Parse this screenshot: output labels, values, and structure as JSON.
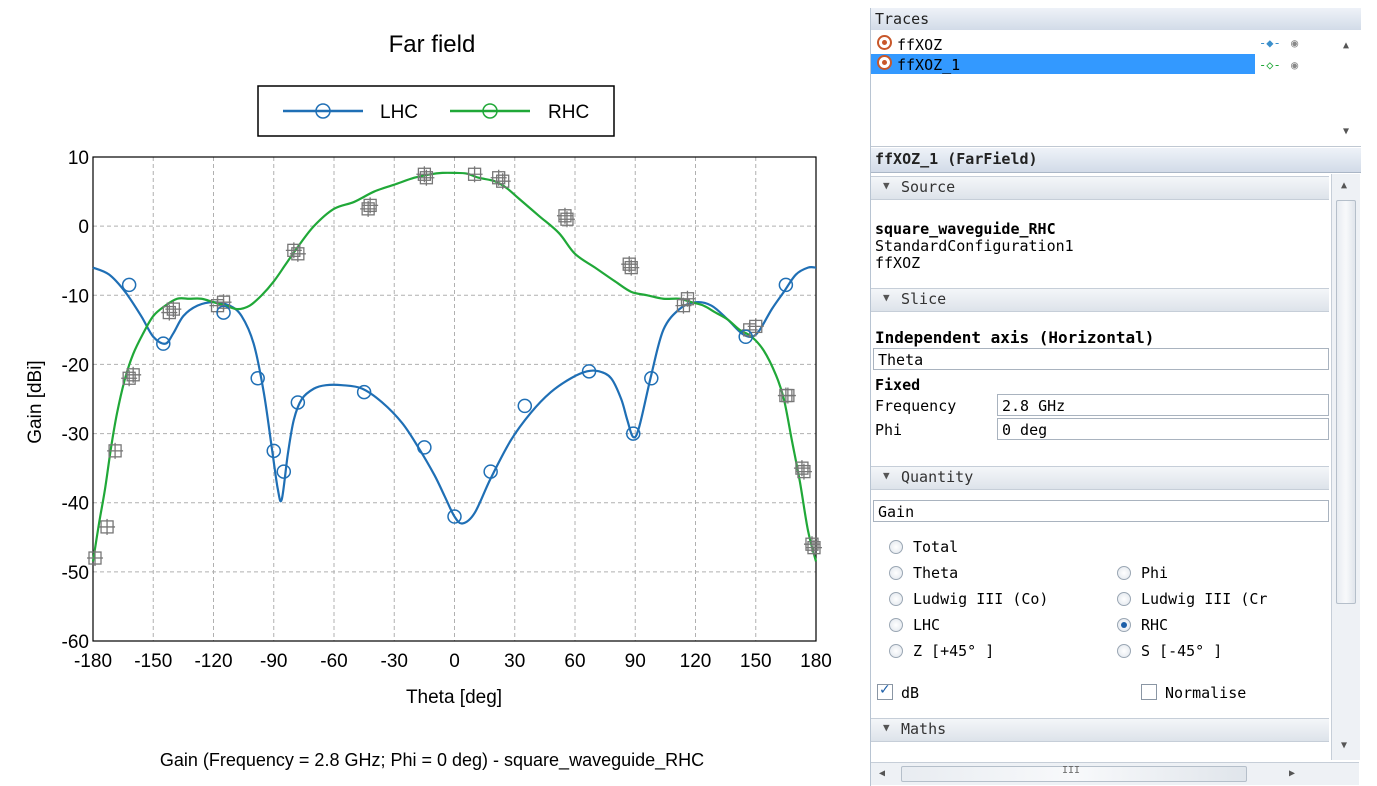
{
  "chart_data": {
    "type": "line",
    "title": "Far field",
    "xlabel": "Theta [deg]",
    "ylabel": "Gain [dBi]",
    "xlim": [
      -180,
      180
    ],
    "ylim": [
      -60,
      10
    ],
    "xticks": [
      -180,
      -150,
      -120,
      -90,
      -60,
      -30,
      0,
      30,
      60,
      90,
      120,
      150,
      180
    ],
    "yticks": [
      10,
      0,
      -10,
      -20,
      -30,
      -40,
      -50,
      -60
    ],
    "grid": true,
    "legend_position": "top-center",
    "footer": "Gain (Frequency = 2.8 GHz; Phi = 0 deg) - square_waveguide_RHC",
    "series": [
      {
        "name": "LHC",
        "color": "#1f6fb5",
        "x": [
          -180,
          -172,
          -164,
          -156,
          -150,
          -144,
          -140,
          -135,
          -128,
          -120,
          -112,
          -106,
          -100,
          -95,
          -91,
          -88,
          -86,
          -83,
          -80,
          -76,
          -70,
          -64,
          -56,
          -46,
          -36,
          -26,
          -18,
          -10,
          -5,
          0,
          4,
          10,
          18,
          28,
          38,
          48,
          58,
          66,
          72,
          78,
          83,
          86,
          89,
          92,
          98,
          104,
          112,
          120,
          128,
          136,
          143,
          148,
          152,
          158,
          164,
          170,
          176,
          180
        ],
        "y": [
          -6,
          -7,
          -9.5,
          -13,
          -16,
          -17,
          -15.5,
          -13,
          -11.5,
          -11,
          -11.5,
          -13,
          -17,
          -24,
          -32,
          -38,
          -39.5,
          -33,
          -28,
          -25,
          -23.5,
          -23,
          -23,
          -23.5,
          -25.5,
          -28.5,
          -32,
          -36,
          -39,
          -42,
          -43,
          -41.5,
          -36.5,
          -31,
          -27,
          -24,
          -22,
          -21,
          -21,
          -22,
          -25,
          -28,
          -30.5,
          -29,
          -21.5,
          -15,
          -12,
          -11,
          -11.5,
          -13.5,
          -15.5,
          -16,
          -15,
          -12,
          -9.5,
          -7,
          -6,
          -6
        ]
      },
      {
        "name": "RHC",
        "color": "#20a838",
        "x": [
          -180,
          -177,
          -174,
          -171,
          -168,
          -164,
          -160,
          -155,
          -150,
          -144,
          -138,
          -132,
          -126,
          -120,
          -114,
          -108,
          -102,
          -96,
          -90,
          -84,
          -78,
          -70,
          -60,
          -50,
          -40,
          -30,
          -20,
          -12,
          -6,
          0,
          6,
          12,
          20,
          26,
          32,
          42,
          52,
          60,
          70,
          80,
          88,
          96,
          104,
          112,
          118,
          124,
          130,
          136,
          142,
          148,
          154,
          160,
          164,
          168,
          172,
          176,
          180
        ],
        "y": [
          -48.5,
          -43,
          -38,
          -32,
          -27,
          -22,
          -18.5,
          -15.5,
          -13,
          -11.5,
          -10.5,
          -10.5,
          -10.5,
          -11,
          -11.5,
          -12,
          -11.5,
          -10,
          -8,
          -5.5,
          -3,
          0,
          2.5,
          3.5,
          5,
          6,
          7,
          7.5,
          7.7,
          7.7,
          7.6,
          7,
          6.5,
          5.5,
          4,
          1.5,
          -1,
          -4,
          -6,
          -8,
          -9.5,
          -10,
          -10.5,
          -10.5,
          -11,
          -11.5,
          -12.5,
          -13.5,
          -15,
          -16,
          -18,
          -21.5,
          -25,
          -31,
          -37,
          -44,
          -48.5
        ]
      }
    ],
    "markers_lhc": {
      "x": [
        -162,
        -145,
        -115,
        -98,
        -90,
        -85,
        -78,
        -45,
        -15,
        0,
        18,
        35,
        67,
        89,
        98,
        145,
        165
      ],
      "y": [
        -8.5,
        -17,
        -12.5,
        -22,
        -32.5,
        -35.5,
        -25.5,
        -24,
        -32,
        -42,
        -35.5,
        -26,
        -21,
        -30,
        -22,
        -16,
        -8.5
      ]
    },
    "markers_rhc": {
      "x": [
        -179,
        -173,
        -169,
        -162,
        -160,
        -142,
        -140,
        -118,
        -115,
        -80,
        -78,
        -43,
        -42,
        -15,
        -14,
        10,
        22,
        24,
        55,
        56,
        87,
        88,
        114,
        116,
        147,
        150,
        165,
        166,
        173,
        174,
        178,
        179
      ],
      "y": [
        -48,
        -43.5,
        -32.5,
        -22,
        -21.5,
        -12.5,
        -12,
        -11.5,
        -11,
        -3.5,
        -4,
        2.5,
        3,
        7.5,
        7,
        7.5,
        7,
        6.5,
        1.5,
        1,
        -5.5,
        -6,
        -11.5,
        -10.5,
        -15,
        -14.5,
        -24.5,
        -24.5,
        -35,
        -35.5,
        -46,
        -46.5
      ]
    }
  },
  "traces": {
    "header": "Traces",
    "items": [
      {
        "label": "ffXOZ"
      },
      {
        "label": "ffXOZ_1"
      }
    ]
  },
  "properties": {
    "title": "ffXOZ_1 (FarField)",
    "source": {
      "section": "Source",
      "name": "square_waveguide_RHC",
      "config": "StandardConfiguration1",
      "trace": "ffXOZ"
    },
    "slice": {
      "section": "Slice",
      "independent_axis_label": "Independent axis (Horizontal)",
      "independent_axis_value": "Theta",
      "fixed_label": "Fixed",
      "frequency_label": "Frequency",
      "frequency_value": "2.8 GHz",
      "phi_label": "Phi",
      "phi_value": "0 deg"
    },
    "quantity": {
      "section": "Quantity",
      "value": "Gain",
      "options": [
        "Total",
        "Theta",
        "Phi",
        "Ludwig III (Co)",
        "Ludwig III (Cr",
        "LHC",
        "RHC",
        "Z [+45° ]",
        "S [-45° ]"
      ],
      "selected": "RHC",
      "db_label": "dB",
      "db_checked": true,
      "normalise_label": "Normalise",
      "normalise_checked": false
    },
    "maths": {
      "section": "Maths"
    }
  },
  "scrollbar": {
    "h_mark": "III"
  }
}
